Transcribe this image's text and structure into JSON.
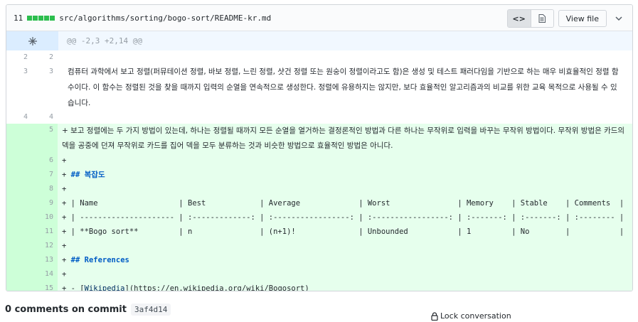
{
  "file": {
    "changes": "11",
    "path": "src/algorithms/sorting/bogo-sort/README-kr.md",
    "view_file_label": "View file",
    "hunk_header": "@@ -2,3 +2,14 @@"
  },
  "context_lines": [
    {
      "old": "2",
      "new": "2",
      "text": ""
    },
    {
      "old": "3",
      "new": "3",
      "text": "컴퓨터 과학에서 보고 정렬(퍼뮤테이션 정렬, 바보 정렬, 느린 정렬, 샷건 정렬 또는 원숭이 정렬이라고도 함)은 생성 및 테스트 패러다임을 기반으로 하는 매우 비효율적인 정렬 함수이다. 이 함수는 정렬된 것을 찾을 때까지 입력의 순열을 연속적으로 생성한다. 정렬에 유용하지는 않지만, 보다 효율적인 알고리즘과의 비교를 위한 교육 목적으로 사용될 수 있습니다."
    },
    {
      "old": "4",
      "new": "4",
      "text": ""
    }
  ],
  "added_lines": [
    {
      "n": "5",
      "text": "+ 보고 정렬에는 두 가지 방법이 있는데, 하나는 정렬될 때까지 모든 순열을 열거하는 결정론적인 방법과 다른 하나는 무작위로 입력을 바꾸는 무작위 방법이다. 무작위 방법은 카드의 덱을 공중에 던져 무작위로 카드를 집어 덱을 모두 분류하는 것과 비슷한 방법으로 효율적인 방법은 아니다."
    },
    {
      "n": "6",
      "text": "+"
    },
    {
      "n": "7",
      "prefix": "+ ",
      "head": "## 복잡도"
    },
    {
      "n": "8",
      "text": "+"
    },
    {
      "n": "9",
      "text": "+ | Name                  | Best            | Average             | Worst               | Memory    | Stable    | Comments  |"
    },
    {
      "n": "10",
      "text": "+ | --------------------- | :-------------: | :-----------------: | :-----------------: | :-------: | :-------: | :-------- |"
    },
    {
      "n": "11",
      "text": "+ | **Bogo sort**         | n               | (n+1)!              | Unbounded           | 1         | No        |           |"
    },
    {
      "n": "12",
      "text": "+"
    },
    {
      "n": "13",
      "prefix": "+ ",
      "head": "## References"
    },
    {
      "n": "14",
      "text": "+"
    },
    {
      "n": "15",
      "prefix": "+ - [",
      "link": "Wikipedia",
      "suffix": "](https://en.wikipedia.org/wiki/Bogosort)"
    }
  ],
  "footer": {
    "comments_label": "0 comments on commit",
    "sha": "3af4d14",
    "lock_label": "Lock conversation"
  },
  "colors": {
    "addition": "#e6ffed",
    "addition_gutter": "#cdffd8",
    "hunk": "#f1f8ff",
    "diffstat": "#2cbe4e"
  },
  "icons": [
    "code-icon",
    "file-icon",
    "chevron-down-icon",
    "unfold-icon",
    "lock-icon"
  ]
}
